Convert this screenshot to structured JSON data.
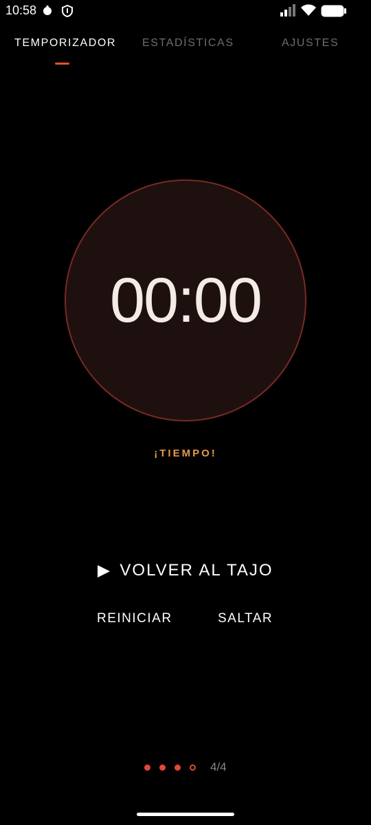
{
  "status_bar": {
    "time": "10:58",
    "icons": [
      "record-dot-icon",
      "shield-icon",
      "signal-icon",
      "wifi-icon",
      "battery-icon"
    ]
  },
  "tabs": [
    {
      "label": "TEMPORIZADOR",
      "active": true
    },
    {
      "label": "ESTADÍSTICAS",
      "active": false
    },
    {
      "label": "AJUSTES",
      "active": false
    }
  ],
  "timer": {
    "display": "00:00",
    "status": "¡TIEMPO!"
  },
  "actions": {
    "resume_label": "VOLVER AL TAJO",
    "reset_label": "REINICIAR",
    "skip_label": "SALTAR"
  },
  "pager": {
    "label": "4/4",
    "current": 4,
    "total": 4
  },
  "colors": {
    "accent": "#e8502b",
    "status_text": "#e49a4a",
    "circle_fill": "#1f1010",
    "circle_border": "#7a2a24"
  }
}
